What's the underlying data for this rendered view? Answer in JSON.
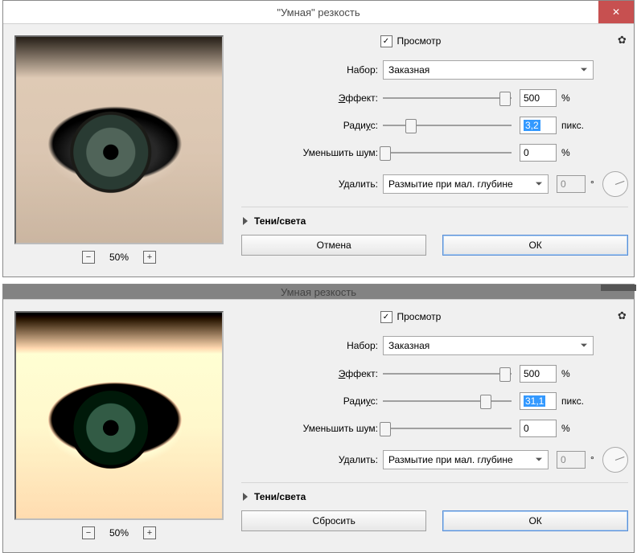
{
  "dialogs": [
    {
      "title": "\"Умная\" резкость",
      "close_glyph": "✕",
      "preview_checked": true,
      "preview_label": "Просмотр",
      "zoom_level": "50%",
      "preset": {
        "label": "Набор:",
        "value": "Заказная"
      },
      "amount": {
        "label_pre": "Э",
        "label_post": "ффект:",
        "value": "500",
        "unit": "%",
        "thumb_pct": 95
      },
      "radius": {
        "label_pre": "Ради",
        "label_u": "у",
        "label_post": "с:",
        "value": "3,2",
        "unit": "пикс.",
        "thumb_pct": 22
      },
      "noise": {
        "label": "Уменьшить шум:",
        "value": "0",
        "unit": "%",
        "thumb_pct": 2
      },
      "remove": {
        "label": "Удалить:",
        "value": "Размытие при мал. глубине",
        "angle_value": "0",
        "angle_unit": "°"
      },
      "section_shadows": "Тени/света",
      "cancel": "Отмена",
      "ok": "ОК"
    },
    {
      "title": "Умная  резкость",
      "close_glyph": "",
      "preview_checked": true,
      "preview_label": "Просмотр",
      "zoom_level": "50%",
      "preset": {
        "label": "Набор:",
        "value": "Заказная"
      },
      "amount": {
        "label_pre": "Э",
        "label_post": "ффект:",
        "value": "500",
        "unit": "%",
        "thumb_pct": 95
      },
      "radius": {
        "label_pre": "Ради",
        "label_u": "у",
        "label_post": "с:",
        "value": "31,1",
        "unit": "пикс.",
        "thumb_pct": 80
      },
      "noise": {
        "label": "Уменьшить шум:",
        "value": "0",
        "unit": "%",
        "thumb_pct": 2
      },
      "remove": {
        "label": "Удалить:",
        "value": "Размытие при мал. глубине",
        "angle_value": "0",
        "angle_unit": "°"
      },
      "section_shadows": "Тени/света",
      "cancel": "Сбросить",
      "ok": "ОК"
    }
  ]
}
